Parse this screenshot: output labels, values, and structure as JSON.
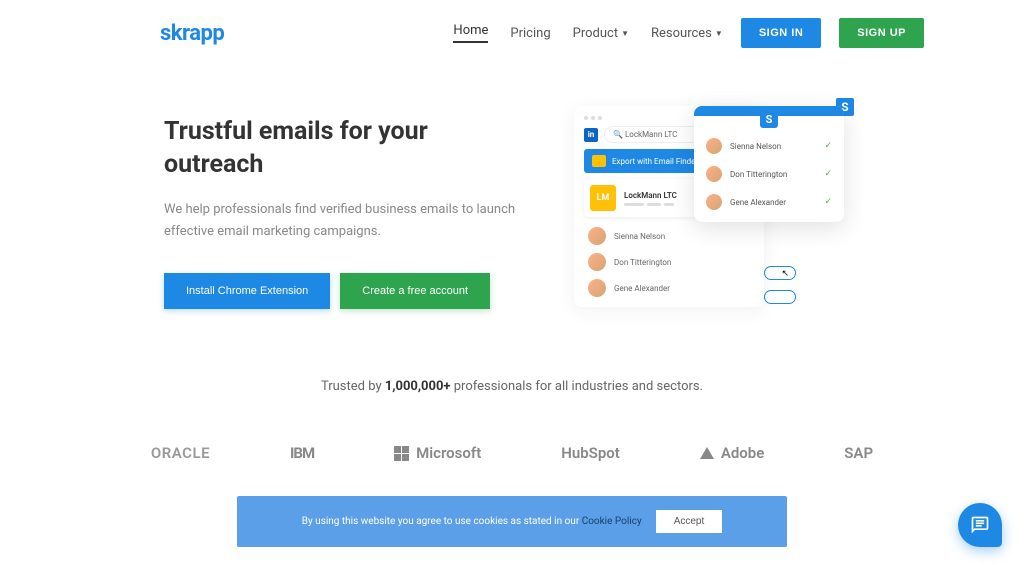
{
  "logo": "skrapp",
  "nav": {
    "home": "Home",
    "pricing": "Pricing",
    "product": "Product",
    "resources": "Resources",
    "signin": "SIGN IN",
    "signup": "SIGN UP"
  },
  "hero": {
    "title": "Trustful emails for your outreach",
    "subtitle": "We help professionals find verified business emails to launch effective email marketing campaigns.",
    "cta1": "Install Chrome Extension",
    "cta2": "Create a free account"
  },
  "mockup": {
    "search": "LockMann LTC",
    "export": "Export with Email Finder",
    "card_initials": "LM",
    "card_name": "LockMann LTC",
    "people": [
      "Sienna Nelson",
      "Don Titterington",
      "Gene Alexander"
    ]
  },
  "popup": {
    "people": [
      "Sienna Nelson",
      "Don Titterington",
      "Gene Alexander"
    ]
  },
  "trusted": {
    "prefix": "Trusted by ",
    "count": "1,000,000+",
    "suffix": " professionals for all industries and sectors."
  },
  "brands": {
    "oracle": "ORACLE",
    "ibm": "IBM",
    "microsoft": "Microsoft",
    "hubspot": "HubSpot",
    "adobe": "Adobe",
    "sap": "SAP"
  },
  "cookie": {
    "text": "By using this website you agree to use cookies as stated in our ",
    "link": "Cookie Policy",
    "accept": "Accept"
  }
}
